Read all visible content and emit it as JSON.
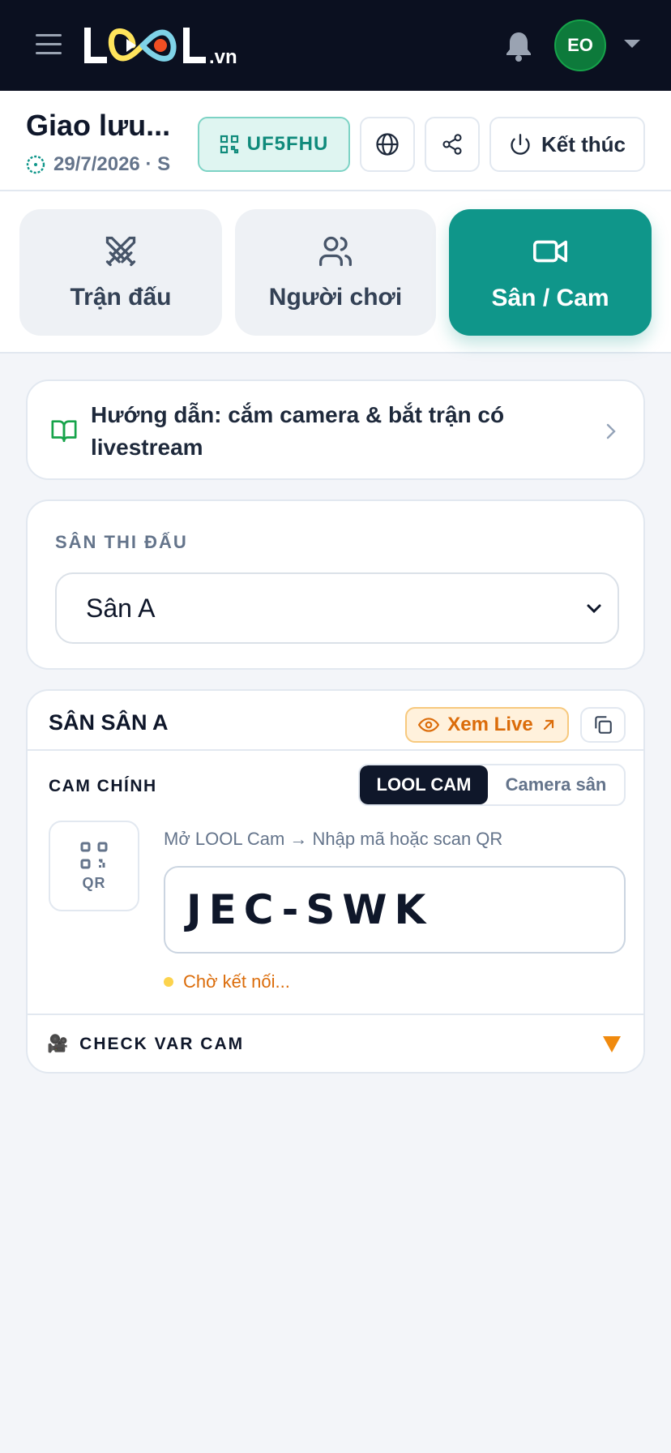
{
  "colors": {
    "topbar": "#0b1020",
    "brand_teal": "#0f968a",
    "avatar_green": "#0d7a3b",
    "live_orange": "#db6c0a"
  },
  "header": {
    "logo_text": "LOOL.vn",
    "avatar_initials": "EO",
    "icons": [
      "menu-icon",
      "bell-icon",
      "chevron-down-icon"
    ]
  },
  "event": {
    "title": "Giao lưu...",
    "date_meta": "29/7/2026 · S",
    "code": "UF5FHU",
    "end_label": "Kết thúc"
  },
  "tabs": [
    {
      "label": "Trận đấu",
      "icon": "swords-icon",
      "active": false
    },
    {
      "label": "Người chơi",
      "icon": "users-icon",
      "active": false
    },
    {
      "label": "Sân / Cam",
      "icon": "video-icon",
      "active": true
    }
  ],
  "guide": {
    "text": "Hướng dẫn: cắm camera & bắt trận có livestream"
  },
  "court_select": {
    "label": "SÂN THI ĐẤU",
    "value": "Sân A"
  },
  "camera_card": {
    "title": "SÂN SÂN A",
    "live_label": "Xem Live",
    "cam_label": "CAM CHÍNH",
    "segments": [
      "LOOL CAM",
      "Camera sân"
    ],
    "selected_segment": "LOOL CAM",
    "qr_label": "QR",
    "instruction": "Mở LOOL Cam → Nhập mã hoặc scan QR",
    "pair_code": "JEC-SWK",
    "status": "Chờ kết nối...",
    "var_label": "CHECK VAR CAM",
    "var_emoji": "🎥"
  }
}
